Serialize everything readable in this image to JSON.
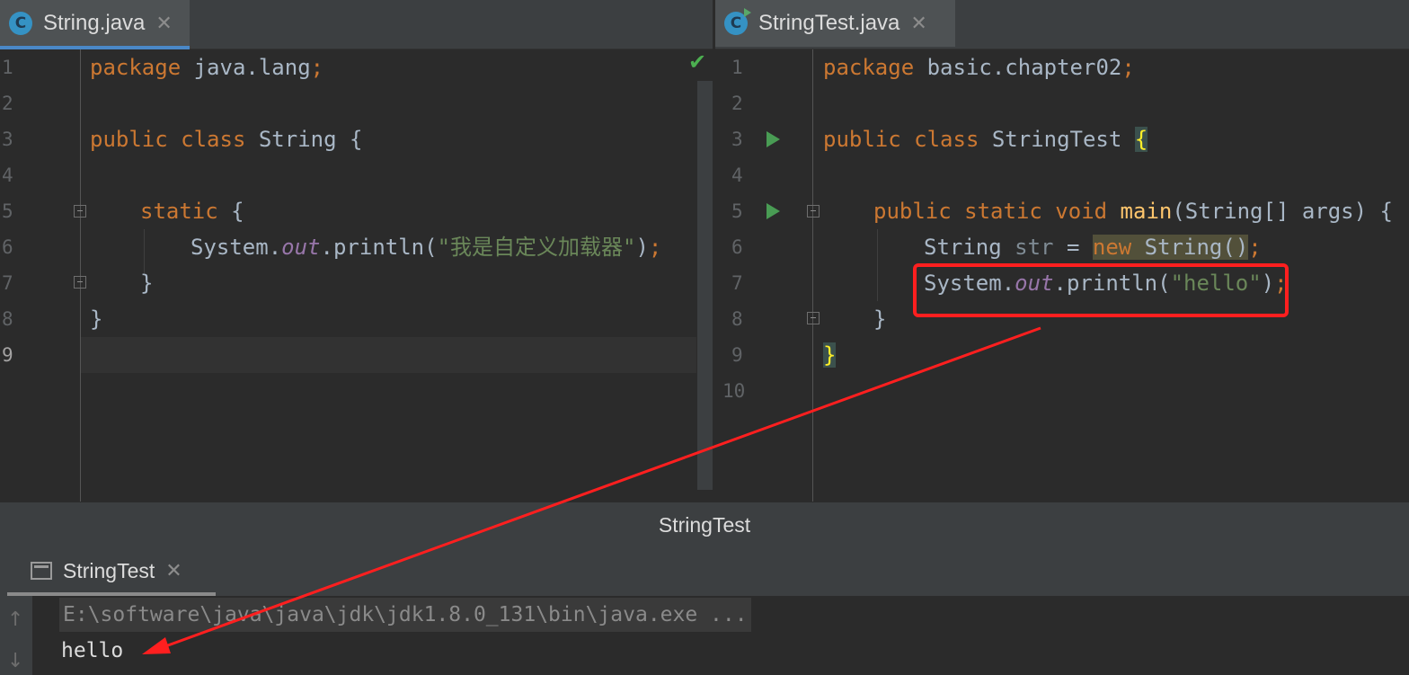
{
  "left_tab": {
    "title": "String.java",
    "icon": "java-class-icon",
    "close": "✕"
  },
  "right_tab": {
    "title": "StringTest.java",
    "icon": "java-class-run-icon",
    "close": "✕"
  },
  "left_editor": {
    "line_numbers": [
      "1",
      "2",
      "3",
      "4",
      "5",
      "6",
      "7",
      "8",
      "9"
    ],
    "code": {
      "l1_kw": "package",
      "l1_rest": " java.lang",
      "l1_semi": ";",
      "l3_kw": "public class",
      "l3_rest": " String {",
      "l5_kw": "static",
      "l5_rest": " {",
      "l6_a": "System.",
      "l6_field": "out",
      "l6_b": ".println(",
      "l6_str": "\"我是自定义加载器\"",
      "l6_c": ")",
      "l6_semi": ";",
      "l7": "}",
      "l8": "}"
    },
    "status": "✔"
  },
  "right_editor": {
    "line_numbers": [
      "1",
      "2",
      "3",
      "4",
      "5",
      "6",
      "7",
      "8",
      "9",
      "10"
    ],
    "code": {
      "l1_kw": "package",
      "l1_rest": " basic.chapter02",
      "l1_semi": ";",
      "l3_kw": "public class",
      "l3_rest": " StringTest ",
      "l3_brace": "{",
      "l5_kw": "public static void",
      "l5_fn": "main",
      "l5_rest": "(String[] args) {",
      "l6_type": "String ",
      "l6_var": "str",
      "l6_eq": " = ",
      "l6_new": "new",
      "l6_rest": " String()",
      "l6_semi": ";",
      "l7_a": "System.",
      "l7_field": "out",
      "l7_b": ".println(",
      "l7_str": "\"hello\"",
      "l7_c": ")",
      "l7_semi": ";",
      "l8": "}",
      "l9_brace": "}"
    }
  },
  "navigation_bar": {
    "label": "StringTest"
  },
  "run_panel": {
    "tab_title": "StringTest",
    "tab_icon": "console-icon",
    "close": "✕",
    "command": "E:\\software\\java\\java\\jdk\\jdk1.8.0_131\\bin\\java.exe ...",
    "output": "hello",
    "up_arrow": "↑",
    "down_arrow": "↓"
  },
  "annotation": {
    "box_color": "#ff1f1f",
    "arrow_color": "#ff1f1f"
  }
}
